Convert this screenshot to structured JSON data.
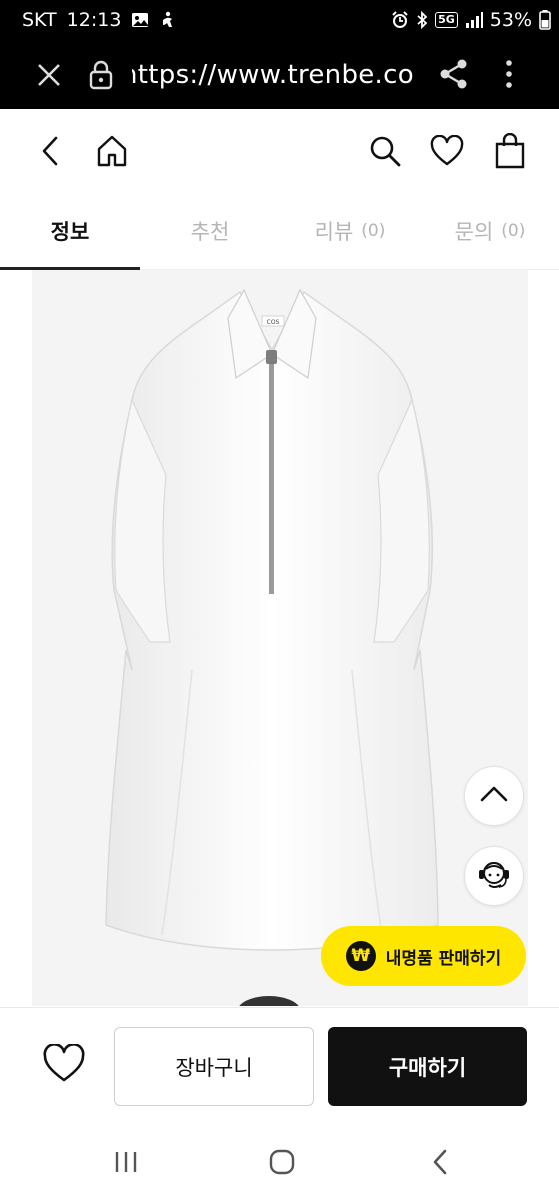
{
  "status_bar": {
    "carrier": "SKT",
    "time": "12:13",
    "battery": "53%",
    "icons": [
      "image-icon",
      "accessibility-icon",
      "alarm-icon",
      "bluetooth-icon",
      "5g-icon",
      "signal-icon",
      "battery-icon"
    ],
    "network_badge": "5G"
  },
  "browser": {
    "url": "https://www.trenbe.com/p",
    "icons": [
      "close-icon",
      "lock-icon",
      "share-icon",
      "more-vertical-icon"
    ]
  },
  "header": {
    "icons": [
      "back-icon",
      "home-icon",
      "search-icon",
      "heart-icon",
      "bag-icon"
    ]
  },
  "tabs": [
    {
      "label": "정보",
      "count": "",
      "active": true
    },
    {
      "label": "추천",
      "count": "",
      "active": false
    },
    {
      "label": "리뷰",
      "count": "(0)",
      "active": false
    },
    {
      "label": "문의",
      "count": "(0)",
      "active": false
    }
  ],
  "product": {
    "brand_tag": "COS",
    "image": "white-zip-shirt-dress"
  },
  "floating": {
    "scroll_top_icon": "chevron-up-icon",
    "support_icon": "headset-agent-icon",
    "sell_label": "내명품 판매하기",
    "sell_icon": "₩"
  },
  "actions": {
    "wishlist_icon": "heart-outline-icon",
    "cart_label": "장바구니",
    "buy_label": "구매하기"
  },
  "android_nav": {
    "icons": [
      "recent-apps-icon",
      "home-circle-icon",
      "back-chevron-icon"
    ]
  },
  "colors": {
    "accent_yellow": "#ffe600",
    "buy_button": "#111111",
    "tab_inactive": "#b5b5b5"
  }
}
